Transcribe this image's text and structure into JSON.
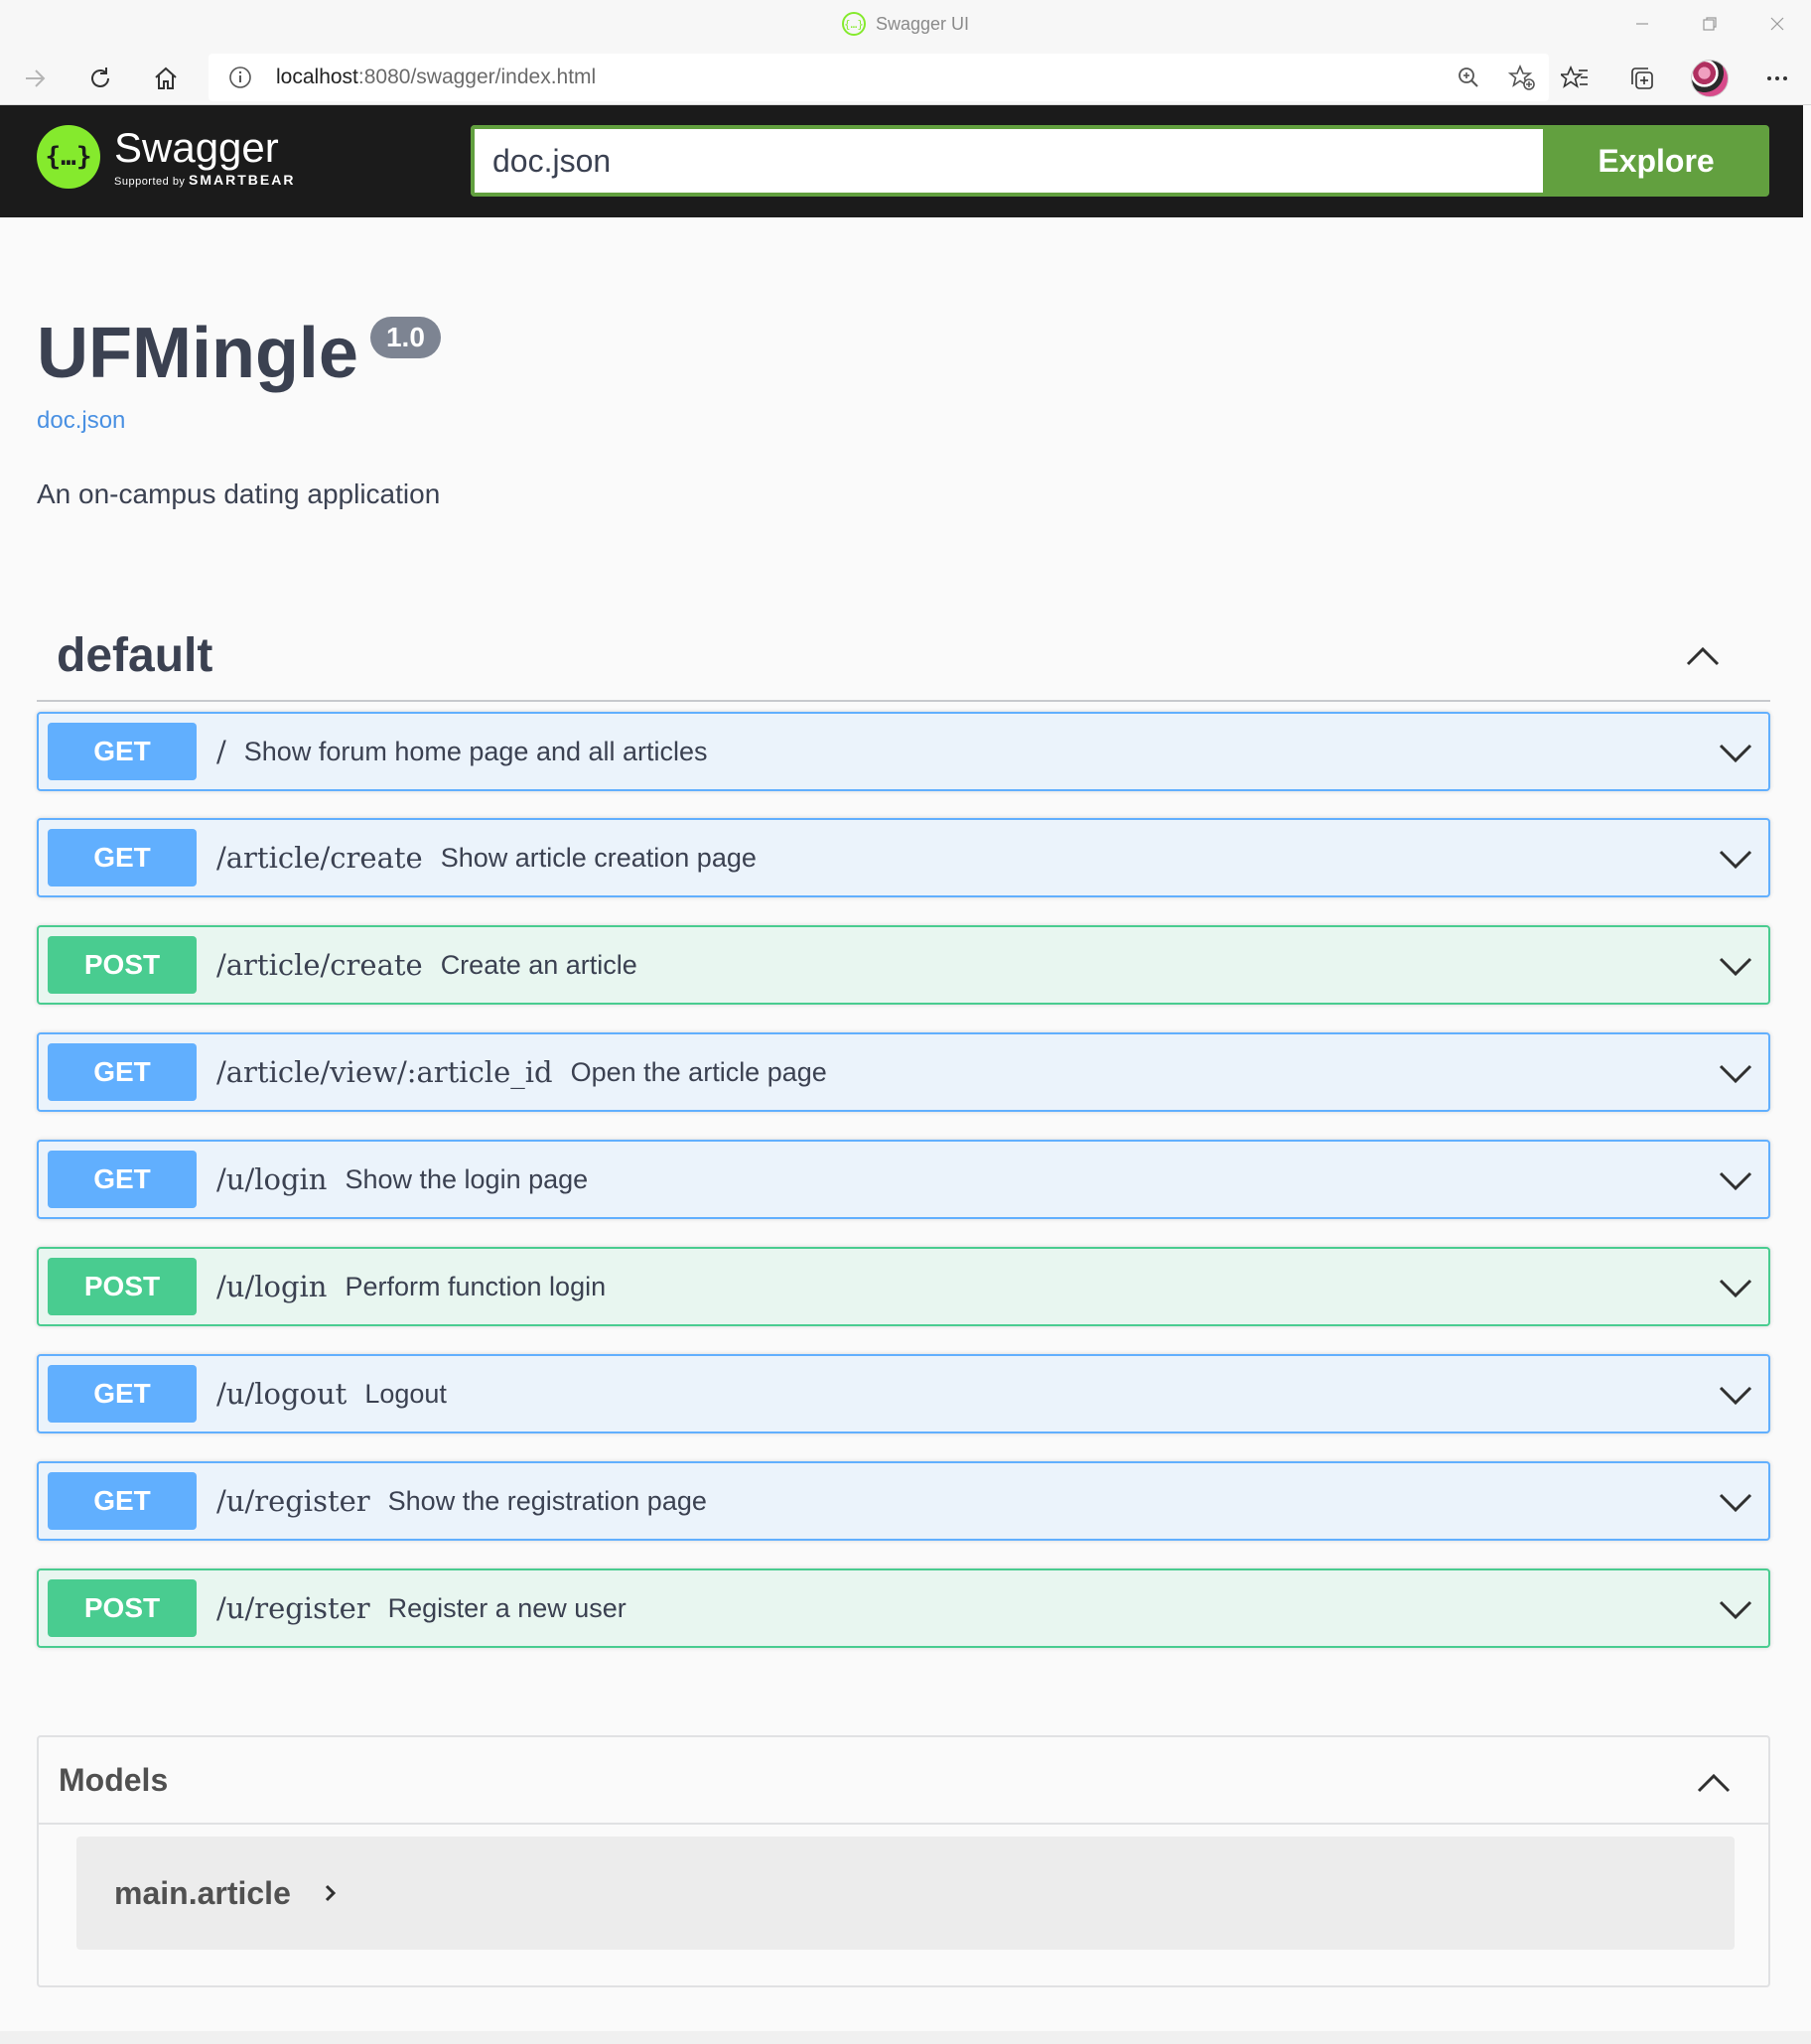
{
  "browser": {
    "tab_title": "Swagger UI",
    "url_host": "localhost",
    "url_rest": ":8080/swagger/index.html",
    "icons": [
      "back-arrow-icon",
      "reload-icon",
      "home-icon",
      "info-icon",
      "zoom-icon",
      "add-favorite-icon",
      "favorites-icon",
      "collections-icon",
      "more-icon"
    ]
  },
  "topbar": {
    "logo_word": "Swagger",
    "logo_sub_prefix": "Supported by",
    "logo_sub_brand": "SMARTBEAR",
    "spec_url_value": "doc.json",
    "explore_label": "Explore",
    "colors": {
      "background": "#1b1b1b",
      "accent": "#62a03f",
      "logo": "#85ea2d"
    }
  },
  "info": {
    "title": "UFMingle",
    "version": "1.0",
    "spec_link": "doc.json",
    "description": "An on-campus dating application"
  },
  "tag": {
    "name": "default",
    "expanded": true,
    "operations": [
      {
        "method": "GET",
        "path": "/",
        "summary": "Show forum home page and all articles"
      },
      {
        "method": "GET",
        "path": "/article/create",
        "summary": "Show article creation page"
      },
      {
        "method": "POST",
        "path": "/article/create",
        "summary": "Create an article"
      },
      {
        "method": "GET",
        "path": "/article/view/:article_id",
        "summary": "Open the article page"
      },
      {
        "method": "GET",
        "path": "/u/login",
        "summary": "Show the login page"
      },
      {
        "method": "POST",
        "path": "/u/login",
        "summary": "Perform function login"
      },
      {
        "method": "GET",
        "path": "/u/logout",
        "summary": "Logout"
      },
      {
        "method": "GET",
        "path": "/u/register",
        "summary": "Show the registration page"
      },
      {
        "method": "POST",
        "path": "/u/register",
        "summary": "Register a new user"
      }
    ],
    "method_colors": {
      "GET": "#61affe",
      "POST": "#49cc90"
    }
  },
  "models": {
    "title": "Models",
    "items": [
      {
        "name": "main.article"
      }
    ]
  }
}
